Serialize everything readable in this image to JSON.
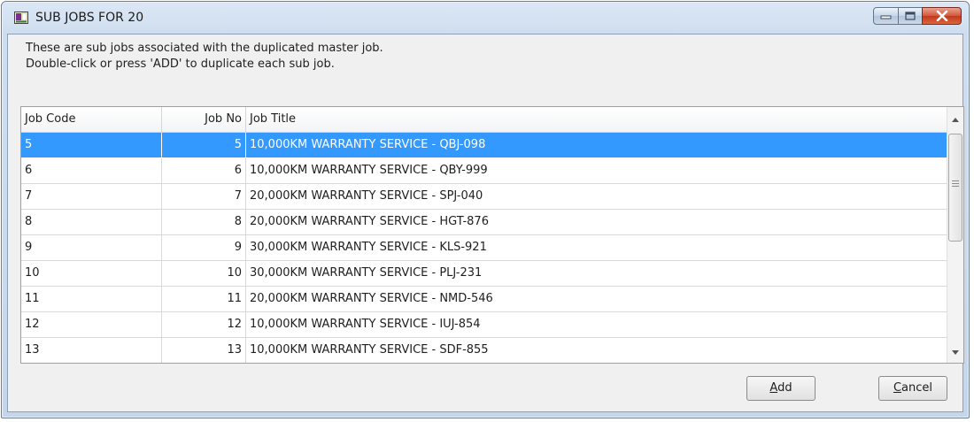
{
  "window": {
    "title": "SUB JOBS FOR 20",
    "icon": "app-window-icon",
    "controls": [
      "minimize-icon",
      "maximize-icon",
      "close-icon"
    ]
  },
  "info": {
    "line1": "These are sub jobs associated with the duplicated master job.",
    "line2": "Double-click or press 'ADD' to duplicate each sub job."
  },
  "grid": {
    "columns": [
      "Job Code",
      "Job No",
      "Job Title"
    ],
    "rows": [
      {
        "code": "5",
        "no": "5",
        "title": "10,000KM WARRANTY SERVICE - QBJ-098",
        "selected": true
      },
      {
        "code": "6",
        "no": "6",
        "title": "10,000KM WARRANTY SERVICE - QBY-999"
      },
      {
        "code": "7",
        "no": "7",
        "title": "20,000KM WARRANTY SERVICE -  SPJ-040"
      },
      {
        "code": "8",
        "no": "8",
        "title": "20,000KM WARRANTY SERVICE - HGT-876"
      },
      {
        "code": "9",
        "no": "9",
        "title": "30,000KM WARRANTY SERVICE - KLS-921"
      },
      {
        "code": "10",
        "no": "10",
        "title": "30,000KM WARRANTY SERVICE - PLJ-231"
      },
      {
        "code": "11",
        "no": "11",
        "title": "20,000KM WARRANTY SERVICE - NMD-546"
      },
      {
        "code": "12",
        "no": "12",
        "title": "10,000KM WARRANTY SERVICE - IUJ-854"
      },
      {
        "code": "13",
        "no": "13",
        "title": "10,000KM WARRANTY SERVICE - SDF-855"
      }
    ]
  },
  "buttons": {
    "add": {
      "mnemonic": "A",
      "rest": "dd"
    },
    "cancel": {
      "mnemonic": "C",
      "rest": "ancel"
    }
  },
  "colors": {
    "selection": "#3399ff",
    "close_button": "#c2381d"
  }
}
